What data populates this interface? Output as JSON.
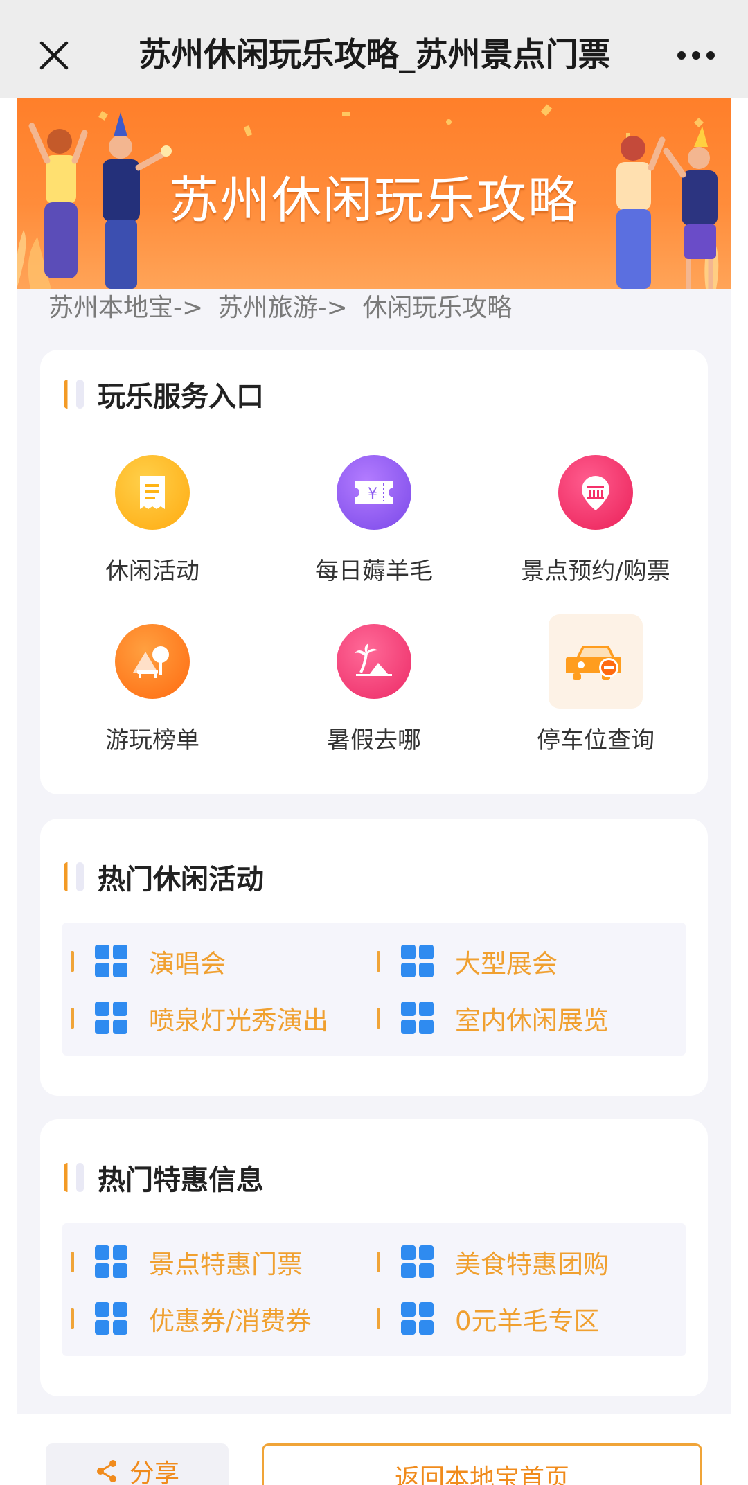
{
  "nav": {
    "title": "苏州休闲玩乐攻略_苏州景点门票",
    "close_icon": "close-icon",
    "more_icon": "more-icon"
  },
  "banner": {
    "title": "苏州休闲玩乐攻略"
  },
  "breadcrumb": {
    "items": [
      "苏州本地宝->",
      "苏州旅游->",
      "休闲玩乐攻略"
    ]
  },
  "services": {
    "title": "玩乐服务入口",
    "items": [
      {
        "label": "休闲活动",
        "icon": "receipt-icon",
        "color": "#ffb415"
      },
      {
        "label": "每日薅羊毛",
        "icon": "ticket-icon",
        "color": "#8d5df0"
      },
      {
        "label": "景点预约/购票",
        "icon": "landmark-pin-icon",
        "color": "#f5306a"
      },
      {
        "label": "游玩榜单",
        "icon": "park-icon",
        "color": "#ff7a22"
      },
      {
        "label": "暑假去哪",
        "icon": "palm-beach-icon",
        "color": "#f53a7a"
      },
      {
        "label": "停车位查询",
        "icon": "car-icon",
        "color": "#ff9d1e"
      }
    ]
  },
  "hot_activities": {
    "title": "热门休闲活动",
    "links": [
      "演唱会",
      "大型展会",
      "喷泉灯光秀演出",
      "室内休闲展览"
    ]
  },
  "hot_deals": {
    "title": "热门特惠信息",
    "links": [
      "景点特惠门票",
      "美食特惠团购",
      "优惠券/消费券",
      "0元羊毛专区"
    ]
  },
  "footer": {
    "share_label": "分享",
    "home_label": "返回本地宝首页"
  },
  "colors": {
    "accent": "#f0a030",
    "link_icon": "#2f8bf0"
  }
}
